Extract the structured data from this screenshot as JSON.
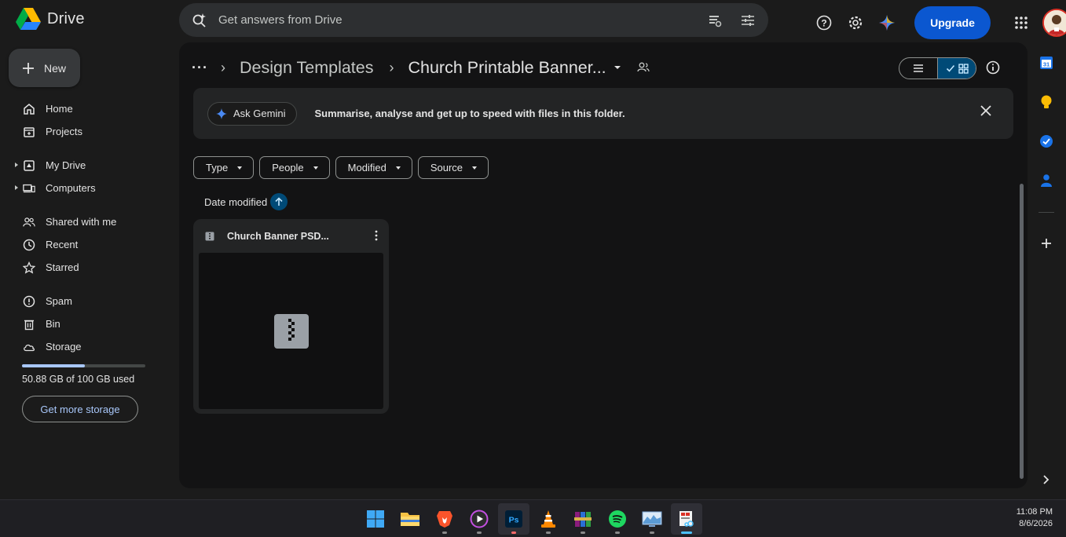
{
  "app": {
    "name": "Drive",
    "search_placeholder": "Get answers from Drive",
    "upgrade_label": "Upgrade"
  },
  "sidebar": {
    "new_label": "New",
    "items": [
      {
        "label": "Home",
        "icon": "home-icon"
      },
      {
        "label": "Projects",
        "icon": "projects-icon"
      },
      {
        "label": "My Drive",
        "icon": "my-drive-icon"
      },
      {
        "label": "Computers",
        "icon": "computers-icon"
      },
      {
        "label": "Shared with me",
        "icon": "shared-icon"
      },
      {
        "label": "Recent",
        "icon": "recent-icon"
      },
      {
        "label": "Starred",
        "icon": "star-icon"
      },
      {
        "label": "Spam",
        "icon": "spam-icon"
      },
      {
        "label": "Bin",
        "icon": "bin-icon"
      },
      {
        "label": "Storage",
        "icon": "cloud-icon"
      }
    ],
    "storage_text": "50.88 GB of 100 GB used",
    "storage_fraction": 0.5088,
    "get_storage_label": "Get more storage"
  },
  "breadcrumb": {
    "parent": "Design Templates",
    "current": "Church Printable Banner..."
  },
  "gemini": {
    "button_label": "Ask Gemini",
    "message": "Summarise, analyse and get up to speed with files in this folder."
  },
  "filters": [
    "Type",
    "People",
    "Modified",
    "Source"
  ],
  "sort": {
    "label": "Date modified",
    "direction": "ascending"
  },
  "files": [
    {
      "name": "Church Banner PSD...",
      "type": "zip"
    }
  ],
  "colors": {
    "accent": "#0b57d0",
    "accent_light": "#a8c7fa",
    "selected": "#004a77"
  },
  "taskbar": {
    "time": "11:08 PM",
    "date": "8/6/2026",
    "apps": [
      "windows-start",
      "file-explorer",
      "brave-browser",
      "media-player",
      "photoshop",
      "vlc",
      "winrar",
      "spotify",
      "resource-monitor",
      "snipping-tool"
    ]
  }
}
